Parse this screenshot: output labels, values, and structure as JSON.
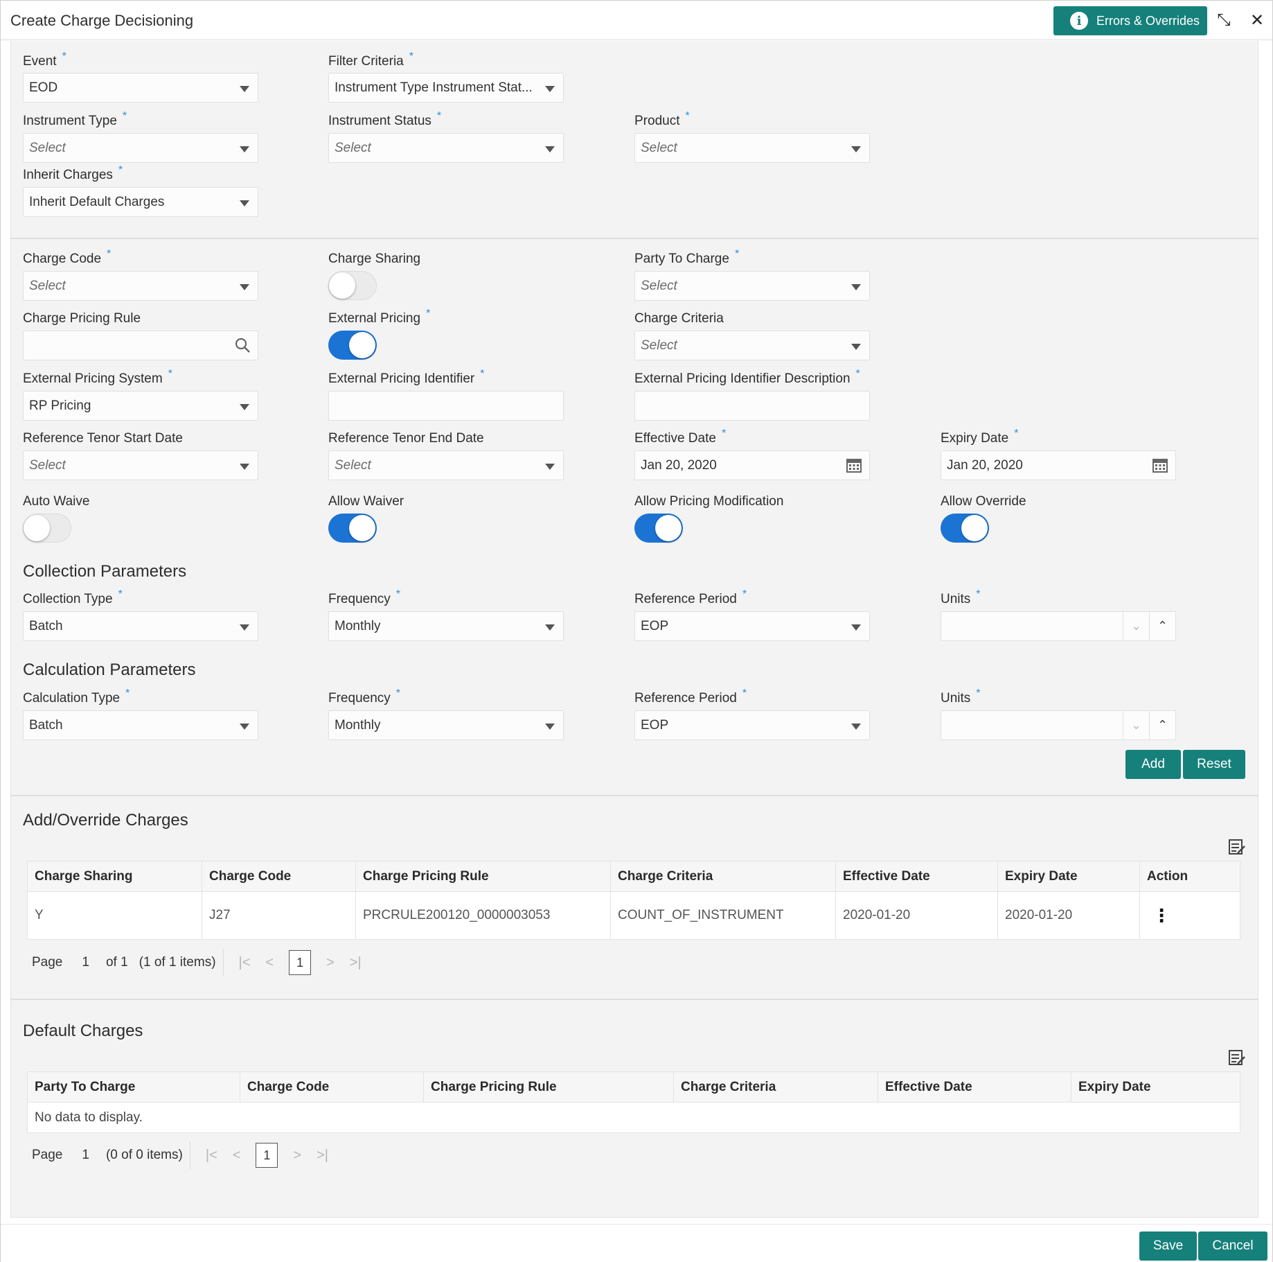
{
  "header": {
    "title": "Create Charge Decisioning",
    "errors_button": "Errors & Overrides",
    "info_glyph": "i",
    "minimize_glyph": "⤡",
    "close_glyph": "✕"
  },
  "top_form": {
    "event": {
      "label": "Event",
      "value": "EOD"
    },
    "filter_criteria": {
      "label": "Filter Criteria",
      "value": "Instrument Type Instrument Stat..."
    },
    "instrument_type": {
      "label": "Instrument Type",
      "value": "Select"
    },
    "instrument_status": {
      "label": "Instrument Status",
      "value": "Select"
    },
    "product": {
      "label": "Product",
      "value": "Select"
    },
    "inherit_charges": {
      "label": "Inherit Charges",
      "value": "Inherit Default Charges"
    }
  },
  "charge_form": {
    "charge_code": {
      "label": "Charge Code",
      "value": "Select"
    },
    "charge_sharing": {
      "label": "Charge Sharing",
      "on": false
    },
    "party_to_charge": {
      "label": "Party To Charge",
      "value": "Select"
    },
    "charge_pricing_rule": {
      "label": "Charge Pricing Rule",
      "value": ""
    },
    "external_pricing": {
      "label": "External Pricing",
      "on": true
    },
    "charge_criteria": {
      "label": "Charge Criteria",
      "value": "Select"
    },
    "external_pricing_system": {
      "label": "External Pricing System",
      "value": "RP Pricing"
    },
    "external_pricing_identifier": {
      "label": "External Pricing Identifier",
      "value": ""
    },
    "external_pricing_identifier_description": {
      "label": "External Pricing Identifier Description",
      "value": ""
    },
    "ref_tenor_start": {
      "label": "Reference Tenor Start Date",
      "value": "Select"
    },
    "ref_tenor_end": {
      "label": "Reference Tenor End Date",
      "value": "Select"
    },
    "effective_date": {
      "label": "Effective Date",
      "value": "Jan 20, 2020"
    },
    "expiry_date": {
      "label": "Expiry Date",
      "value": "Jan 20, 2020"
    },
    "auto_waive": {
      "label": "Auto Waive",
      "on": false
    },
    "allow_waiver": {
      "label": "Allow Waiver",
      "on": true
    },
    "allow_pricing_modification": {
      "label": "Allow Pricing Modification",
      "on": true
    },
    "allow_override": {
      "label": "Allow Override",
      "on": true
    }
  },
  "collection": {
    "title": "Collection Parameters",
    "type": {
      "label": "Collection Type",
      "value": "Batch"
    },
    "frequency": {
      "label": "Frequency",
      "value": "Monthly"
    },
    "reference_period": {
      "label": "Reference Period",
      "value": "EOP"
    },
    "units": {
      "label": "Units",
      "value": ""
    }
  },
  "calculation": {
    "title": "Calculation Parameters",
    "type": {
      "label": "Calculation Type",
      "value": "Batch"
    },
    "frequency": {
      "label": "Frequency",
      "value": "Monthly"
    },
    "reference_period": {
      "label": "Reference Period",
      "value": "EOP"
    },
    "units": {
      "label": "Units",
      "value": ""
    }
  },
  "buttons": {
    "add": "Add",
    "reset": "Reset",
    "save": "Save",
    "cancel": "Cancel"
  },
  "add_override": {
    "title": "Add/Override Charges",
    "columns": [
      "Charge Sharing",
      "Charge Code",
      "Charge Pricing Rule",
      "Charge Criteria",
      "Effective Date",
      "Expiry Date",
      "Action"
    ],
    "rows": [
      [
        "Y",
        "J27",
        "PRCRULE200120_0000003053",
        "COUNT_OF_INSTRUMENT",
        "2020-01-20",
        "2020-01-20",
        "⋮"
      ]
    ],
    "pager": {
      "page_label": "Page",
      "page": "1",
      "of": "of 1",
      "items": "(1 of 1 items)",
      "current": "1"
    }
  },
  "default_charges": {
    "title": "Default Charges",
    "columns": [
      "Party To Charge",
      "Charge Code",
      "Charge Pricing Rule",
      "Charge Criteria",
      "Effective Date",
      "Expiry Date"
    ],
    "empty": "No data to display.",
    "pager": {
      "page_label": "Page",
      "page": "1",
      "items": "(0 of 0 items)",
      "current": "1"
    }
  },
  "common": {
    "required": "*"
  },
  "colors": {
    "accent": "#16807b",
    "toggle_on": "#1b74d3",
    "required": "#2f8fd8"
  }
}
